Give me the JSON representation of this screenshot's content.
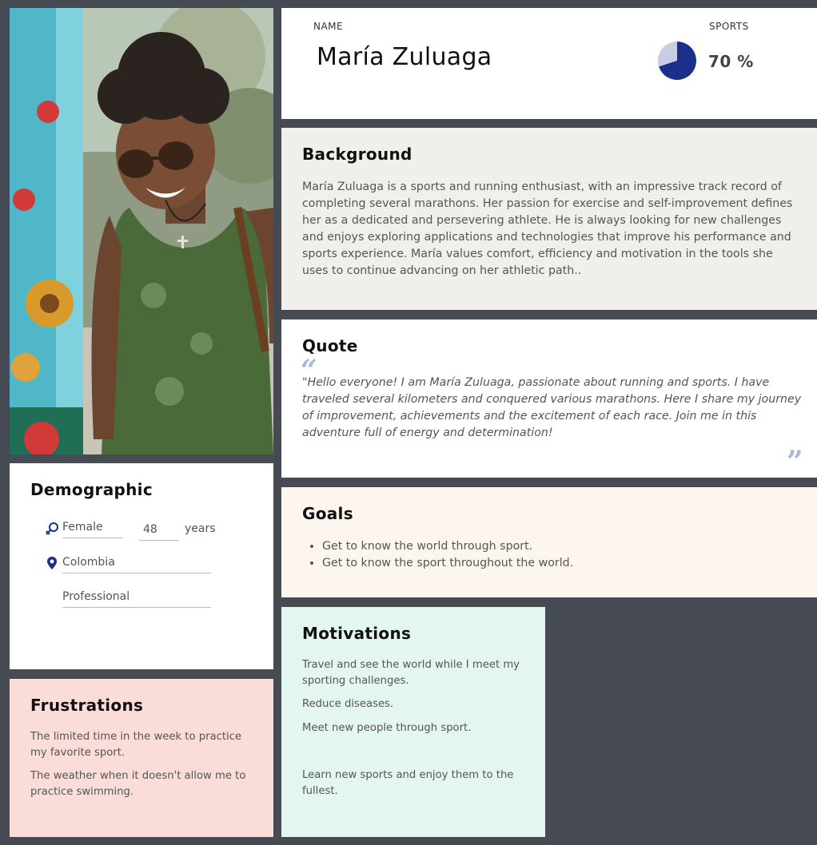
{
  "profile": {
    "name_label": "NAME",
    "name": "María Zuluaga",
    "sports_label": "SPORTS",
    "sports_value": "70 %",
    "sports_fraction": 0.7
  },
  "background": {
    "title": "Background",
    "text": "María Zuluaga is a sports and running enthusiast, with an impressive track record of completing several marathons. Her passion for exercise and self-improvement defines her as a dedicated and persevering athlete. He is always looking for new challenges and enjoys exploring applications and technologies that improve his performance and sports experience. María values comfort, efficiency and motivation in the tools she uses to continue advancing on her athletic path.."
  },
  "quote": {
    "title": "Quote",
    "open_mark": "“",
    "close_mark": "”",
    "text": "\"Hello everyone! I am María Zuluaga, passionate about running and sports. I have traveled several kilometers and conquered various marathons. Here I share my journey of improvement, achievements and the excitement of each race. Join me in this adventure full of energy and determination!"
  },
  "goals": {
    "title": "Goals",
    "items": [
      "Get to know the world through sport.",
      "Get to know the sport throughout the world."
    ]
  },
  "motivations": {
    "title": "Motivations",
    "items": [
      "Travel and see the world while I meet my sporting challenges.",
      "Reduce diseases.",
      "Meet new people through sport.",
      "Learn new sports and enjoy them to the fullest."
    ]
  },
  "demographic": {
    "title": "Demographic",
    "gender": "Female",
    "age": "48",
    "age_unit": "years",
    "country": "Colombia",
    "occupation": "Professional",
    "icons": [
      "gender-icon",
      "location-pin-icon"
    ]
  },
  "frustrations": {
    "title": "Frustrations",
    "items": [
      "The limited time in the week to practice my favorite sport.",
      "The weather when it doesn't allow me to practice swimming."
    ]
  },
  "colors": {
    "page_bg": "#464a53",
    "pie_fill": "#1a2f8a",
    "pie_rest": "#c9cde3",
    "quote_marks": "#aab7d8",
    "background_card": "#f0efec",
    "goals_card": "#fdf6ef",
    "motivations_card": "#e4f6f1",
    "frustrations_card": "#fadcd8"
  }
}
